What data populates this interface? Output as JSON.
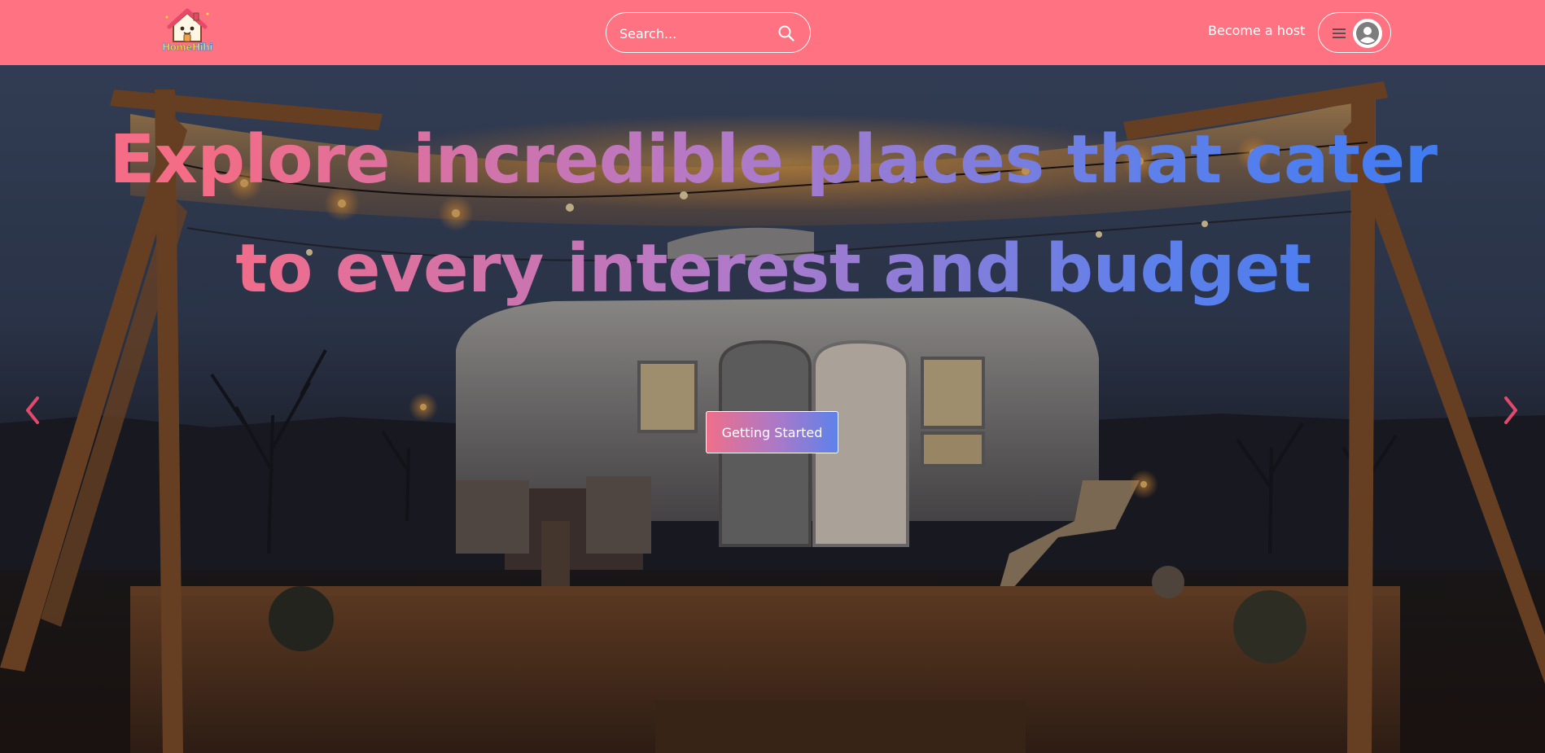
{
  "brand": {
    "logo_text": "HomeHihi",
    "primary_color": "#ff7281"
  },
  "navbar": {
    "search": {
      "placeholder": "Search...",
      "icon": "search-icon"
    },
    "host_link": "Become a host",
    "user_menu": {
      "menu_icon": "hamburger-menu-icon",
      "avatar_icon": "user-avatar-icon"
    }
  },
  "hero": {
    "headline": "Explore incredible places that cater to every interest and budget",
    "cta_label": "Getting Started",
    "gradient_colors": [
      "#f46c86",
      "#b579c7",
      "#5e80ea",
      "#3f7bf2"
    ],
    "prev_icon": "chevron-left-icon",
    "next_icon": "chevron-right-icon",
    "arrow_color": "#e14a6c"
  }
}
